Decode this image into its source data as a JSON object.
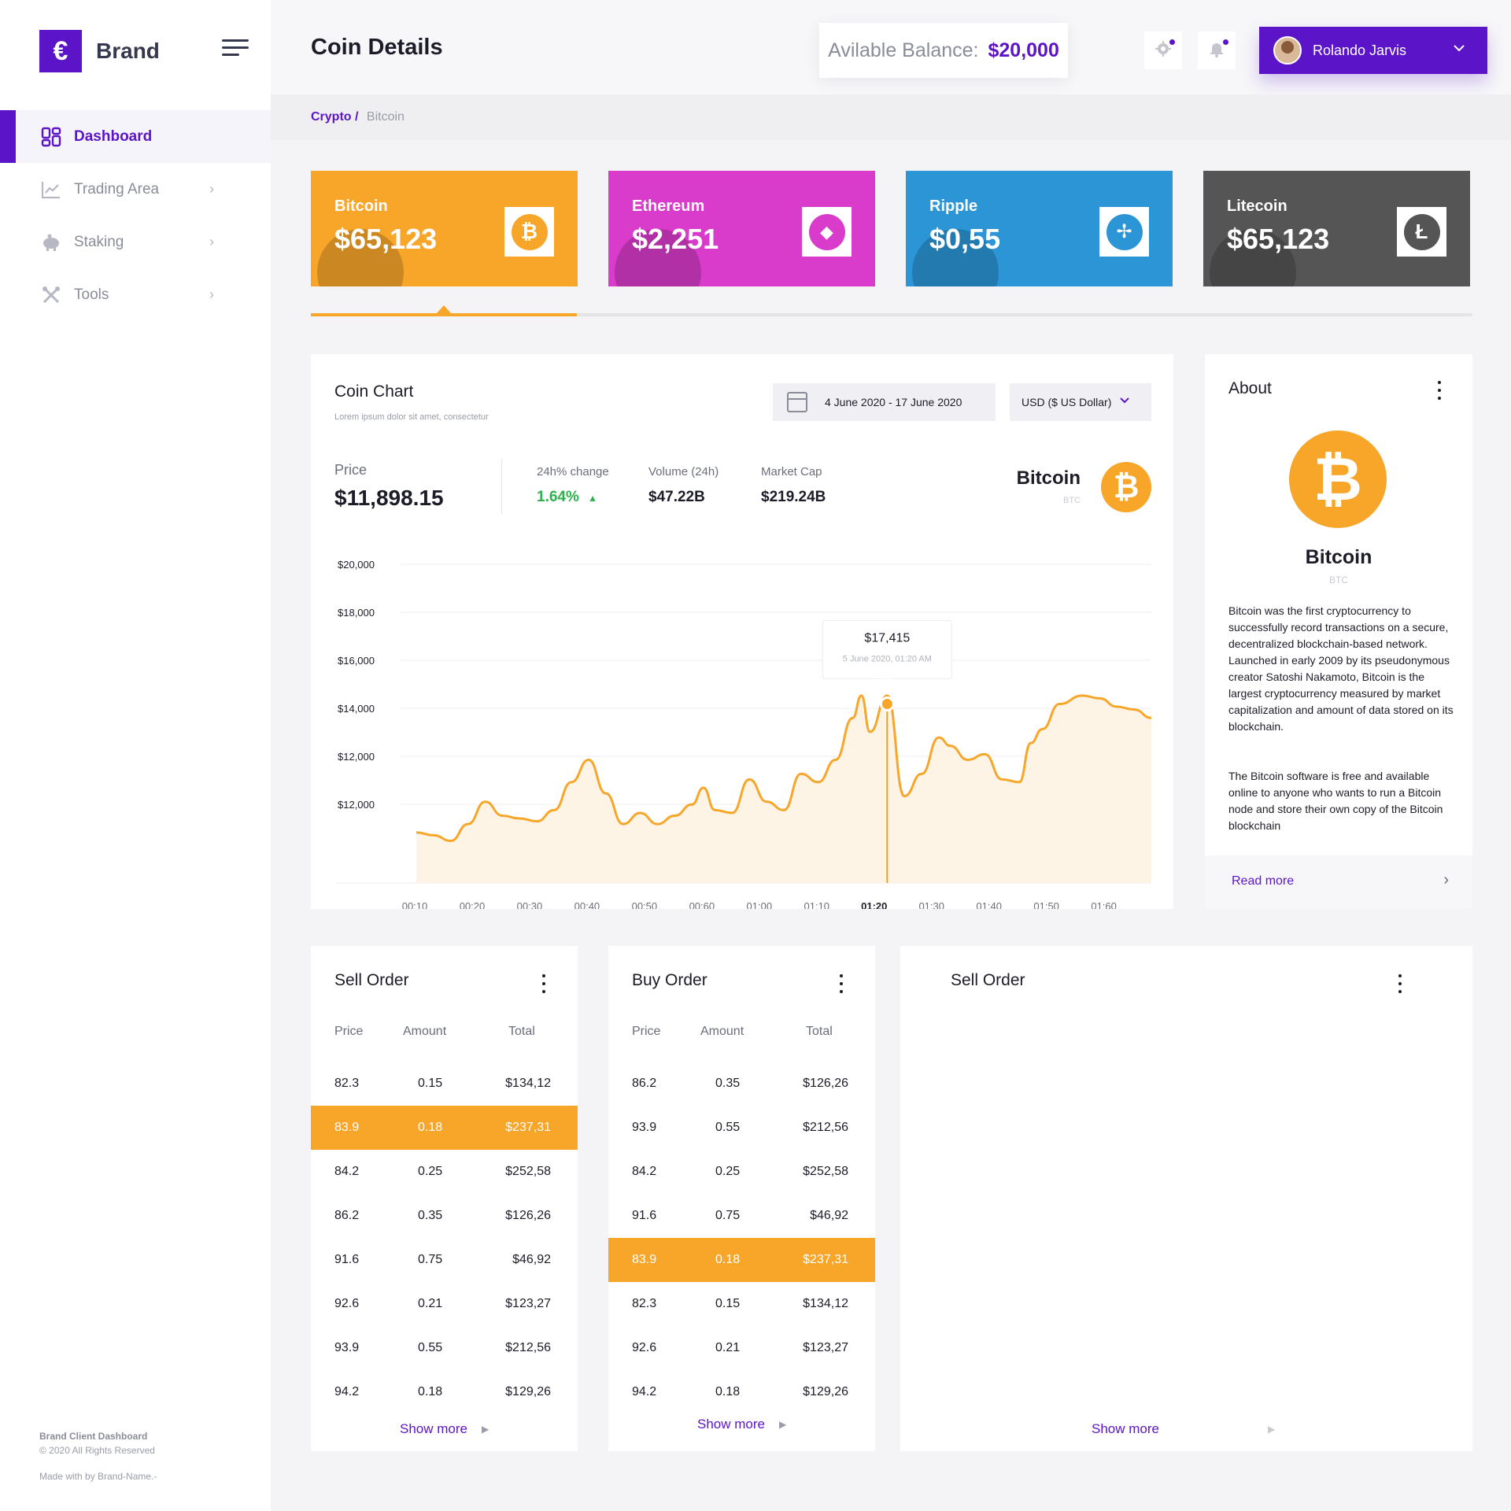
{
  "brand": {
    "name": "Brand",
    "logo_glyph": "€",
    "accent": "#5b14c7"
  },
  "sidebar": {
    "items": [
      {
        "label": "Dashboard",
        "icon": "dashboard-icon",
        "active": true
      },
      {
        "label": "Trading Area",
        "icon": "chart-line-icon",
        "active": false
      },
      {
        "label": "Staking",
        "icon": "piggy-bank-icon",
        "active": false
      },
      {
        "label": "Tools",
        "icon": "tools-icon",
        "active": false
      }
    ],
    "footer": {
      "title": "Brand Client Dashboard",
      "copyright": "© 2020 All Rights Reserved",
      "made_with": "Made with by Brand-Name.-"
    }
  },
  "header": {
    "title": "Coin Details",
    "balance_label": "Avilable  Balance:",
    "balance_value": "$20,000",
    "user_name": "Rolando Jarvis"
  },
  "breadcrumb": {
    "parent": "Crypto /",
    "current": "Bitcoin"
  },
  "coins": [
    {
      "name": "Bitcoin",
      "price": "$65,123",
      "color": "#f8a62a",
      "icon": "bitcoin-icon",
      "glyph": "₿"
    },
    {
      "name": "Ethereum",
      "price": "$2,251",
      "color": "#d93bcb",
      "icon": "ethereum-icon",
      "glyph": "◆"
    },
    {
      "name": "Ripple",
      "price": "$0,55",
      "color": "#2b95d6",
      "icon": "ripple-icon",
      "glyph": "✢"
    },
    {
      "name": "Litecoin",
      "price": "$65,123",
      "color": "#555555",
      "icon": "litecoin-icon",
      "glyph": "Ł"
    }
  ],
  "coin_chart": {
    "title": "Coin Chart",
    "subtitle": "Lorem ipsum dolor sit amet, consectetur",
    "date_range": "4 June 2020 - 17 June 2020",
    "currency": "USD ($ US Dollar)",
    "price_label": "Price",
    "price_value": "$11,898.15",
    "change_label": "24h% change",
    "change_value": "1.64%",
    "volume_label": "Volume (24h)",
    "volume_value": "$47.22B",
    "cap_label": "Market Cap",
    "cap_value": "$219.24B",
    "coin_name": "Bitcoin",
    "coin_symbol": "BTC",
    "tooltip_value": "$17,415",
    "tooltip_date": "5 June 2020, 01:20 AM"
  },
  "chart_data": {
    "type": "area",
    "title": "",
    "xlabel": "",
    "ylabel": "",
    "y_tick_labels": [
      "$20,000",
      "$18,000",
      "$16,000",
      "$14,000",
      "$12,000",
      "$12,000"
    ],
    "ylim": [
      10000,
      20000
    ],
    "x_tick_labels": [
      "00:10",
      "00:20",
      "00:30",
      "00:40",
      "00:50",
      "00:60",
      "01:00",
      "01:10",
      "01:20",
      "01:30",
      "01:40",
      "01:50",
      "01:60"
    ],
    "highlighted_tick": "01:20",
    "grid": true,
    "color": "#f8a62a",
    "fill": "#fdf4e6",
    "series": [
      {
        "x": [
          0,
          0.3,
          0.6,
          0.9,
          1.2,
          1.5,
          1.8,
          2.1,
          2.4,
          2.7,
          3.0,
          3.3,
          3.6,
          3.9,
          4.2,
          4.5,
          4.8,
          5.0,
          5.2,
          5.5,
          5.8,
          6.1,
          6.4,
          6.7,
          7.0,
          7.3,
          7.6,
          7.75,
          7.9,
          8.2,
          8.5,
          8.8,
          9.1,
          9.3,
          9.6,
          9.9,
          10.2,
          10.5,
          10.7,
          10.9,
          11.2,
          11.6,
          11.9,
          12.2,
          12.5,
          12.8
        ],
        "values": [
          10400,
          10300,
          10100,
          10700,
          11500,
          11000,
          10900,
          10800,
          11200,
          12200,
          13000,
          11800,
          10700,
          11100,
          10700,
          11000,
          11400,
          12000,
          11200,
          11100,
          12300,
          11500,
          11200,
          12500,
          12200,
          13000,
          14500,
          15300,
          14000,
          15300,
          11700,
          12500,
          13800,
          13500,
          13000,
          13200,
          12300,
          12200,
          13600,
          14100,
          15000,
          15300,
          15200,
          14900,
          14800,
          14500
        ]
      }
    ],
    "tooltip_point": {
      "x": 8.2,
      "y": 17415
    }
  },
  "about": {
    "title": "About",
    "coin_name": "Bitcoin",
    "coin_symbol": "BTC",
    "paragraph1": "Bitcoin was the first cryptocurrency to successfully record transactions on a secure, decentralized blockchain-based network. Launched in early 2009 by its pseudonymous creator Satoshi Nakamoto, Bitcoin is the largest cryptocurrency measured by market capitalization and amount of data stored on its blockchain.",
    "paragraph2": "The Bitcoin software is free and available online to anyone who wants to run a Bitcoin node and store their own copy of the Bitcoin blockchain",
    "read_more": "Read more"
  },
  "sell_order": {
    "title": "Sell Order",
    "headers": [
      "Price",
      "Amount",
      "Total"
    ],
    "rows": [
      [
        "82.3",
        "0.15",
        "$134,12"
      ],
      [
        "83.9",
        "0.18",
        "$237,31"
      ],
      [
        "84.2",
        "0.25",
        "$252,58"
      ],
      [
        "86.2",
        "0.35",
        "$126,26"
      ],
      [
        "91.6",
        "0.75",
        "$46,92"
      ],
      [
        "92.6",
        "0.21",
        "$123,27"
      ],
      [
        "93.9",
        "0.55",
        "$212,56"
      ],
      [
        "94.2",
        "0.18",
        "$129,26"
      ]
    ],
    "highlight_row": 1,
    "show_more": "Show more"
  },
  "buy_order": {
    "title": "Buy Order",
    "headers": [
      "Price",
      "Amount",
      "Total"
    ],
    "rows": [
      [
        "86.2",
        "0.35",
        "$126,26"
      ],
      [
        "93.9",
        "0.55",
        "$212,56"
      ],
      [
        "84.2",
        "0.25",
        "$252,58"
      ],
      [
        "91.6",
        "0.75",
        "$46,92"
      ],
      [
        "83.9",
        "0.18",
        "$237,31"
      ],
      [
        "82.3",
        "0.15",
        "$134,12"
      ],
      [
        "92.6",
        "0.21",
        "$123,27"
      ],
      [
        "94.2",
        "0.18",
        "$129,26"
      ]
    ],
    "highlight_row": 4,
    "show_more": "Show more"
  },
  "sell_order_2": {
    "title": "Sell Order",
    "show_more": "Show more"
  }
}
